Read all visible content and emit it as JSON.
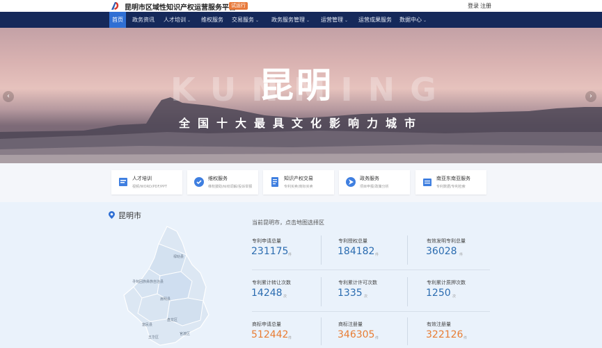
{
  "header": {
    "site_title": "昆明市区域性知识产权运营服务平台",
    "badge": "试运行",
    "login": "登录",
    "register": "注册"
  },
  "nav": {
    "items": [
      {
        "label": "首页",
        "active": true,
        "caret": false
      },
      {
        "label": "政务资讯",
        "active": false,
        "caret": false
      },
      {
        "label": "人才培训",
        "active": false,
        "caret": true
      },
      {
        "label": "维权服务",
        "active": false,
        "caret": false
      },
      {
        "label": "交易服务",
        "active": false,
        "caret": true
      },
      {
        "label": "政务服务管理",
        "active": false,
        "caret": true
      },
      {
        "label": "运营管理",
        "active": false,
        "caret": true
      },
      {
        "label": "运营成果服务",
        "active": false,
        "caret": false
      },
      {
        "label": "数据中心",
        "active": false,
        "caret": true
      }
    ],
    "caret_glyph": "⌄"
  },
  "banner": {
    "bg_word": "KUNMING",
    "title": "昆明",
    "slogan": "全国十大最具文化影响力城市",
    "prev": "‹",
    "next": "›"
  },
  "services": [
    {
      "title": "人才培训",
      "sub": "视频/WORD/PDF/PPT",
      "icon": "book-icon",
      "color": "#3f7fe0"
    },
    {
      "title": "维权服务",
      "sub": "维权援助/纠纷调解/投诉举报",
      "icon": "shield-icon",
      "color": "#3f7fe0"
    },
    {
      "title": "知识产权交易",
      "sub": "专利买卖/商标买卖",
      "icon": "document-icon",
      "color": "#3f7fe0"
    },
    {
      "title": "政务服务",
      "sub": "项目申报/政策分析",
      "icon": "send-icon",
      "color": "#3f7fe0"
    },
    {
      "title": "南亚东南亚服务",
      "sub": "专利数据/专利检索",
      "icon": "folder-icon",
      "color": "#3f7fe0"
    }
  ],
  "location": {
    "name": "昆明市",
    "hint": "当前昆明市，点击地图选择区",
    "map_labels": [
      "禄劝县",
      "寻甸回族彝族自治县",
      "嵩明县",
      "富民县",
      "五华区",
      "官渡区",
      "盘龙区"
    ]
  },
  "stats": [
    {
      "label": "专利申请总量",
      "value": "231175",
      "unit": "件",
      "color": "blue"
    },
    {
      "label": "专利授权总量",
      "value": "184182",
      "unit": "件",
      "color": "blue"
    },
    {
      "label": "有效发明专利总量",
      "value": "36028",
      "unit": "件",
      "color": "blue"
    },
    {
      "label": "专利累计转让次数",
      "value": "14248",
      "unit": "次",
      "color": "blue"
    },
    {
      "label": "专利累计许可次数",
      "value": "1335",
      "unit": "次",
      "color": "blue"
    },
    {
      "label": "专利累计质押次数",
      "value": "1250",
      "unit": "次",
      "color": "blue"
    },
    {
      "label": "商标申请总量",
      "value": "512442",
      "unit": "件",
      "color": "orange"
    },
    {
      "label": "商标注册量",
      "value": "346305",
      "unit": "件",
      "color": "orange"
    },
    {
      "label": "有效注册量",
      "value": "322126",
      "unit": "件",
      "color": "orange"
    }
  ]
}
